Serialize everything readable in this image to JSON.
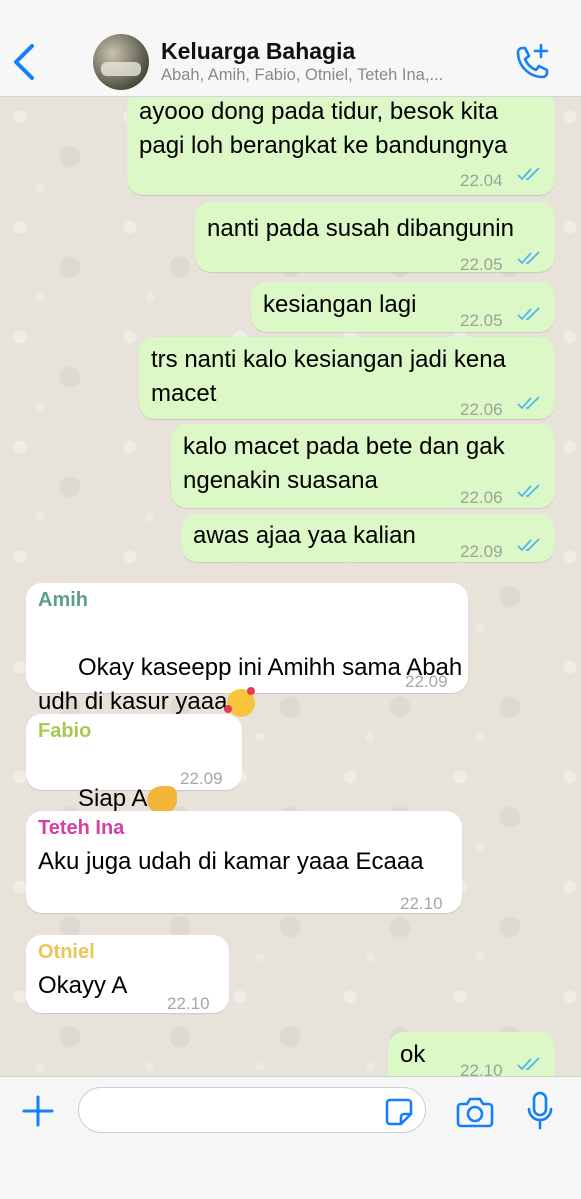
{
  "header": {
    "title": "Keluarga Bahagia",
    "members": "Abah, Amih, Fabio, Otniel, Teteh Ina,..."
  },
  "colors": {
    "accent": "#147efb",
    "outgoing_bubble": "#dcf8c6",
    "incoming_bubble": "#ffffff",
    "read_ticks": "#4fb6ec",
    "sender_amih": "#5c9e8a",
    "sender_fabio": "#a7c94e",
    "sender_teteh_ina": "#d63fa3",
    "sender_otniel": "#e9c657"
  },
  "messages": [
    {
      "direction": "out",
      "text": "ayooo dong pada tidur, besok kita\npagi loh berangkat ke bandungnya",
      "time": "22.04",
      "status": "read"
    },
    {
      "direction": "out",
      "text": "nanti pada susah dibangunin",
      "time": "22.05",
      "status": "read"
    },
    {
      "direction": "out",
      "text": "kesiangan lagi",
      "time": "22.05",
      "status": "read"
    },
    {
      "direction": "out",
      "text": "trs nanti kalo kesiangan jadi kena\nmacet",
      "time": "22.06",
      "status": "read"
    },
    {
      "direction": "out",
      "text": "kalo macet pada bete dan gak\nngenakin suasana",
      "time": "22.06",
      "status": "read"
    },
    {
      "direction": "out",
      "text": "awas ajaa yaa kalian",
      "time": "22.09",
      "status": "read"
    },
    {
      "direction": "in",
      "sender": "Amih",
      "text": "Okay kaseepp ini Amihh sama Abah\nudh di kasur yaaa",
      "emoji": "smiling-face-with-hearts-icon",
      "time": "22.09"
    },
    {
      "direction": "in",
      "sender": "Fabio",
      "text": "Siap A",
      "emoji": "pointing-hand-icon",
      "time": "22.09"
    },
    {
      "direction": "in",
      "sender": "Teteh Ina",
      "text": "Aku juga udah di kamar yaaa Ecaaa",
      "time": "22.10"
    },
    {
      "direction": "in",
      "sender": "Otniel",
      "text": "Okayy A",
      "time": "22.10"
    },
    {
      "direction": "out",
      "text": "ok",
      "time": "22.10",
      "status": "read"
    }
  ],
  "input": {
    "placeholder": ""
  },
  "icons": {
    "back": "chevron-left-icon",
    "call": "add-call-icon",
    "plus": "plus-icon",
    "sticker": "sticker-icon",
    "camera": "camera-icon",
    "mic": "microphone-icon"
  }
}
